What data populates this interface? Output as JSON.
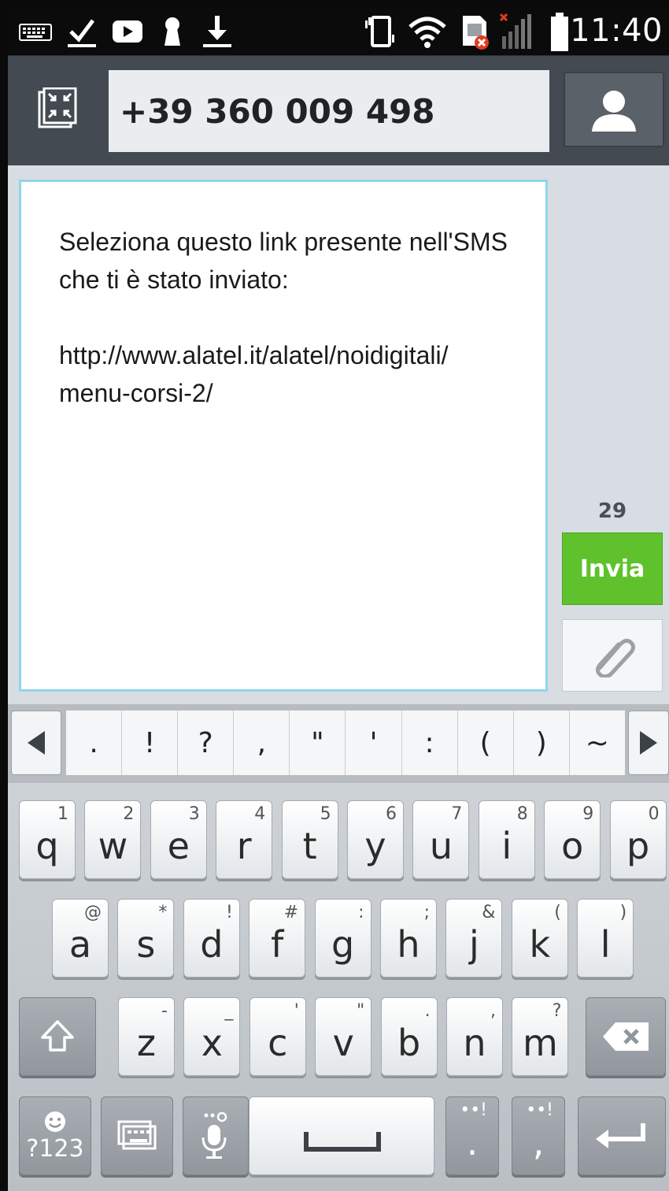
{
  "status_bar": {
    "time": "11:40",
    "left_icons": [
      "keyboard-icon",
      "checkmark-icon",
      "youtube-icon",
      "keyhole-icon",
      "download-icon"
    ],
    "right_icons": [
      "vibrate-icon",
      "wifi-icon",
      "sim-error-icon",
      "signal-icon",
      "battery-icon"
    ]
  },
  "header": {
    "recipient": "+39 360 009 498"
  },
  "compose": {
    "line1": "Seleziona questo link presente nell'SMS",
    "line2": "che ti è stato inviato:",
    "line3": "http://www.alatel.it/alatel/noidigitali/",
    "line4": "menu-corsi-2/",
    "char_count": "29",
    "send_label": "Invia"
  },
  "keyboard": {
    "symbols": [
      ".",
      "!",
      "?",
      ",",
      "\"",
      "'",
      ":",
      "(",
      ")",
      "~"
    ],
    "row1": [
      {
        "label": "q",
        "hint": "1"
      },
      {
        "label": "w",
        "hint": "2"
      },
      {
        "label": "e",
        "hint": "3"
      },
      {
        "label": "r",
        "hint": "4"
      },
      {
        "label": "t",
        "hint": "5"
      },
      {
        "label": "y",
        "hint": "6"
      },
      {
        "label": "u",
        "hint": "7"
      },
      {
        "label": "i",
        "hint": "8"
      },
      {
        "label": "o",
        "hint": "9"
      },
      {
        "label": "p",
        "hint": "0"
      }
    ],
    "row2": [
      {
        "label": "a",
        "hint": "@"
      },
      {
        "label": "s",
        "hint": "*"
      },
      {
        "label": "d",
        "hint": "!"
      },
      {
        "label": "f",
        "hint": "#"
      },
      {
        "label": "g",
        "hint": ":"
      },
      {
        "label": "h",
        "hint": ";"
      },
      {
        "label": "j",
        "hint": "&"
      },
      {
        "label": "k",
        "hint": "("
      },
      {
        "label": "l",
        "hint": ")"
      }
    ],
    "row3": [
      {
        "label": "z",
        "hint": "-"
      },
      {
        "label": "x",
        "hint": "_"
      },
      {
        "label": "c",
        "hint": "'"
      },
      {
        "label": "v",
        "hint": "\""
      },
      {
        "label": "b",
        "hint": "."
      },
      {
        "label": "n",
        "hint": ","
      },
      {
        "label": "m",
        "hint": "?"
      }
    ],
    "symbols_key_label": "?123",
    "period_key": ".",
    "comma_key": ","
  }
}
